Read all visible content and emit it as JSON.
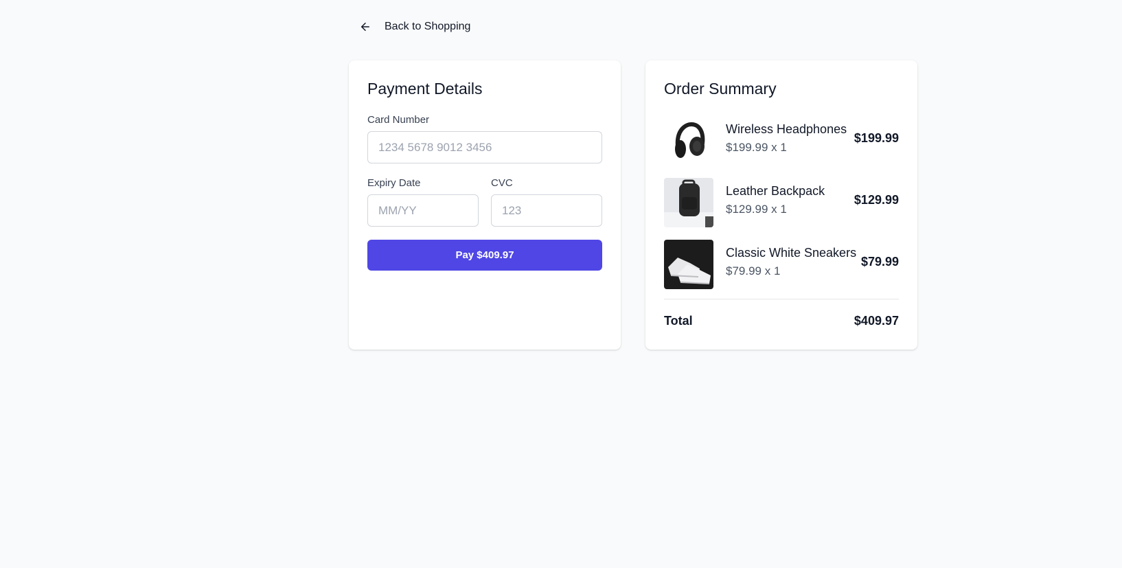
{
  "nav": {
    "back_label": "Back to Shopping",
    "back_icon": "arrow-left-icon"
  },
  "payment": {
    "title": "Payment Details",
    "card_number_label": "Card Number",
    "card_number_placeholder": "1234 5678 9012 3456",
    "card_number_value": "",
    "expiry_label": "Expiry Date",
    "expiry_placeholder": "MM/YY",
    "expiry_value": "",
    "cvc_label": "CVC",
    "cvc_placeholder": "123",
    "cvc_value": "",
    "pay_button_label": "Pay $409.97"
  },
  "summary": {
    "title": "Order Summary",
    "items": [
      {
        "name": "Wireless Headphones",
        "qty_text": "$199.99 x 1",
        "price": "$199.99",
        "image_icon": "headphones-image"
      },
      {
        "name": "Leather Backpack",
        "qty_text": "$129.99 x 1",
        "price": "$129.99",
        "image_icon": "backpack-image"
      },
      {
        "name": "Classic White Sneakers",
        "qty_text": "$79.99 x 1",
        "price": "$79.99",
        "image_icon": "sneakers-image"
      }
    ],
    "total_label": "Total",
    "total_value": "$409.97"
  },
  "colors": {
    "page_bg": "#f9fafb",
    "card_bg": "#ffffff",
    "accent": "#4f46e5",
    "border": "#d1d5db",
    "placeholder": "#9ca3af",
    "muted_text": "#4b5563"
  }
}
